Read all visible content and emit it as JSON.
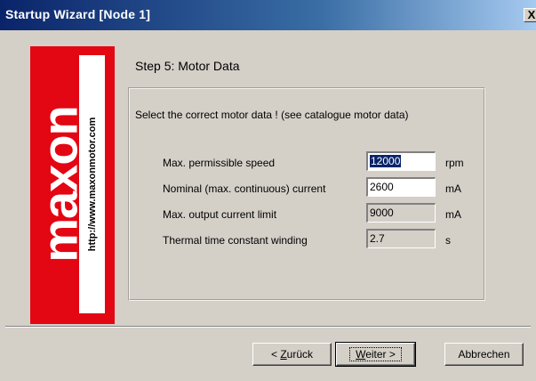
{
  "window": {
    "title": "Startup Wizard  [Node 1]",
    "close_glyph": "X"
  },
  "logo": {
    "brand": "maxon",
    "url": "http://www.maxonmotor.com",
    "color": "#e30613"
  },
  "step": {
    "title": "Step 5: Motor Data"
  },
  "group": {
    "instruction": "Select the correct motor data ! (see catalogue motor data)",
    "rows": [
      {
        "label": "Max. permissible speed",
        "value": "12000",
        "unit": "rpm",
        "editable": true,
        "selected": true
      },
      {
        "label": "Nominal (max. continuous) current",
        "value": "2600",
        "unit": "mA",
        "editable": true,
        "selected": false
      },
      {
        "label": "Max. output current limit",
        "value": "9000",
        "unit": "mA",
        "editable": false,
        "selected": false
      },
      {
        "label": "Thermal time constant winding",
        "value": "2.7",
        "unit": "s",
        "editable": false,
        "selected": false
      }
    ]
  },
  "buttons": {
    "back": {
      "prefix": "< ",
      "mnemonic": "Z",
      "rest": "urück"
    },
    "next": {
      "mnemonic": "W",
      "rest": "eiter >"
    },
    "cancel": {
      "label": "Abbrechen"
    }
  }
}
